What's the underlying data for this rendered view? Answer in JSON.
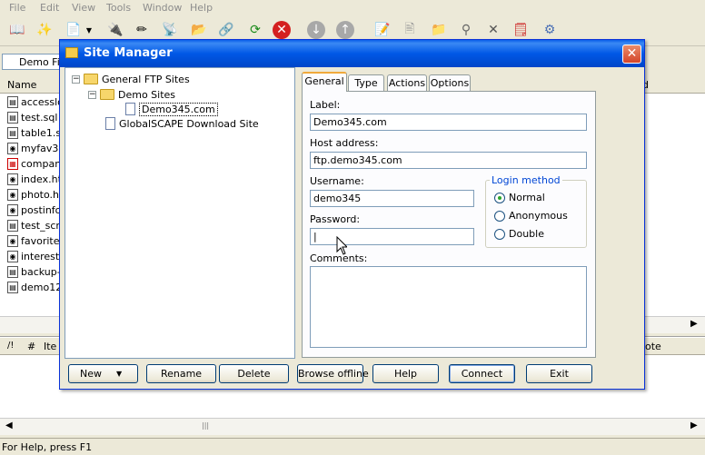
{
  "menu": [
    "File",
    "Edit",
    "View",
    "Tools",
    "Window",
    "Help"
  ],
  "toolbar_icons": [
    "connect-icon",
    "wizard-icon",
    "new-icon",
    "dropdown-icon",
    "disconnect-icon",
    "pencil-icon",
    "satellite-icon",
    "transfer-icon",
    "url-icon",
    "refresh-icon",
    "stop-icon",
    "down-icon",
    "up-icon",
    "edit-icon",
    "rename-icon",
    "newfolder-icon",
    "filter-icon",
    "delete-icon",
    "properties-icon",
    "settings-icon"
  ],
  "address": {
    "value": "Demo Fil"
  },
  "file_pane": {
    "header_name": "Name",
    "right_header": "d",
    "files": [
      "accesslo",
      "test.sql",
      "table1.s",
      "myfav3.",
      "company",
      "index.ht",
      "photo.ht",
      "postinfo",
      "test_scri",
      "favorite.",
      "interest.",
      "backup-f",
      "demo12"
    ]
  },
  "lower_pane": {
    "col1": "/!",
    "col2": "#",
    "col3": "Ite",
    "right": "ote"
  },
  "status": "For Help, press F1",
  "dialog": {
    "title": "Site Manager",
    "close_glyph": "✕",
    "tree": {
      "root": "General FTP Sites",
      "folder": "Demo Sites",
      "site": "Demo345.com",
      "other": "GlobalSCAPE Download Site",
      "collapse_glyph": "−"
    },
    "tabs": [
      "General",
      "Type",
      "Actions",
      "Options"
    ],
    "form": {
      "label_label": "Label:",
      "label_value": "Demo345.com",
      "host_label": "Host address:",
      "host_value": "ftp.demo345.com",
      "username_label": "Username:",
      "username_value": "demo345",
      "password_label": "Password:",
      "password_value": "|",
      "comments_label": "Comments:",
      "comments_value": ""
    },
    "login_method": {
      "legend": "Login method",
      "options": [
        "Normal",
        "Anonymous",
        "Double"
      ],
      "selected": "Normal"
    },
    "buttons": {
      "new": "New",
      "new_arrow": "▼",
      "rename": "Rename",
      "delete": "Delete",
      "browse": "Browse offline",
      "help": "Help",
      "connect": "Connect",
      "exit": "Exit"
    }
  }
}
